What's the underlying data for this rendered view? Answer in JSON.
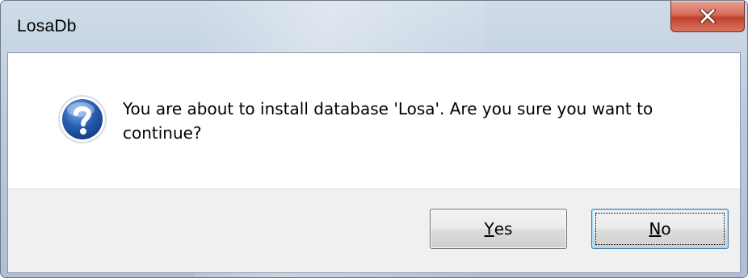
{
  "window": {
    "title": "LosaDb"
  },
  "titlebar": {
    "close_icon": "close-icon",
    "close_color": "#c7402d"
  },
  "dialog": {
    "icon": "question-icon",
    "icon_color": "#2a5fb5",
    "message": "You are about to install database 'Losa'. Are you sure you want to continue?"
  },
  "buttons": {
    "yes": {
      "accel": "Y",
      "rest": "es"
    },
    "no": {
      "accel": "N",
      "rest": "o",
      "focused": true
    }
  }
}
